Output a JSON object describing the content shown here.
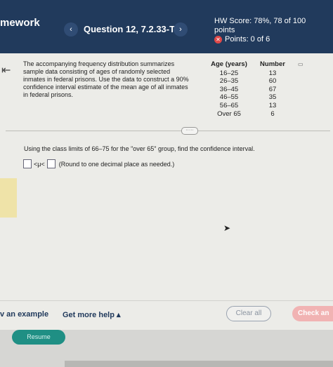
{
  "header": {
    "brand": "mework",
    "prev_icon": "chevron-left-icon",
    "prev_glyph": "‹",
    "question_title": "Question 12, 7.2.33-T",
    "next_icon": "chevron-right-icon",
    "next_glyph": "›",
    "hw_score_line1": "HW Score: 78%, 78 of 100",
    "hw_score_line2": "points",
    "points_icon": "x-circle-icon",
    "points_glyph": "✕",
    "points": "Points: 0 of 6"
  },
  "problem": {
    "description": "The accompanying frequency distribution summarizes sample data consisting of ages of randomly selected inmates in federal prisons. Use the data to construct a 90% confidence interval estimate of the mean age of all inmates in federal prisons.",
    "table": {
      "headers": [
        "Age (years)",
        "Number"
      ],
      "rows": [
        {
          "age": "16–25",
          "number": "13"
        },
        {
          "age": "26–35",
          "number": "60"
        },
        {
          "age": "36–45",
          "number": "67"
        },
        {
          "age": "46–55",
          "number": "35"
        },
        {
          "age": "56–65",
          "number": "13"
        },
        {
          "age": "Over 65",
          "number": "6"
        }
      ]
    },
    "more_glyph": "·····",
    "instruction": "Using the class limits of 66–75 for the \"over 65\" group, find the confidence interval.",
    "answer_middle": "<μ<",
    "answer_hint": "(Round to one decimal place as needed.)"
  },
  "footer": {
    "example_label": "v an example",
    "help_label": "Get more help ▴",
    "clear_label": "Clear all",
    "check_label": "Check an",
    "resume_label": "Resume"
  },
  "colors": {
    "header_bg": "#213a5c",
    "resume_bg": "#1f8f84",
    "check_bg": "#f1b3b3"
  }
}
